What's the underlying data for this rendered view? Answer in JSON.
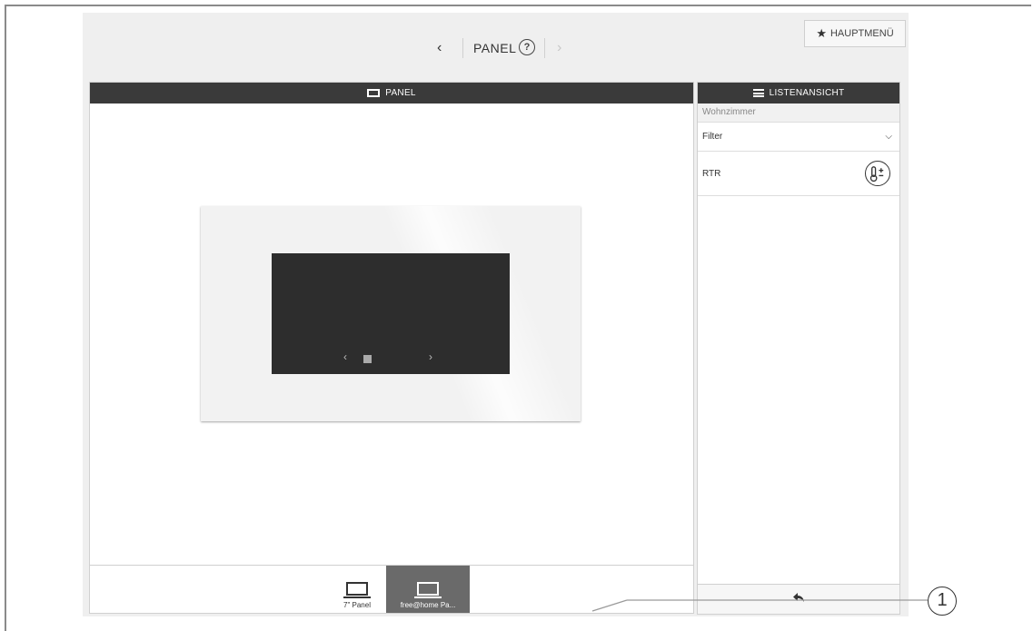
{
  "topnav": {
    "back_icon": "chevron-left-icon",
    "title": "PANEL",
    "help_icon": "question-circle-icon",
    "forward_icon": "chevron-right-icon",
    "main_menu_label": "HAUPTMENÜ",
    "main_menu_icon": "star-icon"
  },
  "panel": {
    "header_label": "PANEL",
    "header_icon": "monitor-icon",
    "device_screen": {
      "prev_icon": "chevron-left-icon",
      "page_indicator_icon": "square-icon",
      "next_icon": "chevron-right-icon"
    },
    "footer_tabs": [
      {
        "label": "7\" Panel",
        "icon": "monitor-icon",
        "active": false
      },
      {
        "label": "free@home Pa...",
        "icon": "monitor-icon",
        "active": true
      }
    ]
  },
  "list_view": {
    "header_label": "LISTENANSICHT",
    "header_icon": "list-icon",
    "room": "Wohnzimmer",
    "filter_label": "Filter",
    "filter_icon": "chevron-down-icon",
    "items": [
      {
        "label": "RTR",
        "icon": "thermostat-plus-minus-icon"
      }
    ],
    "back_icon": "back-arrow-icon"
  },
  "callout": {
    "number": "1"
  },
  "colors": {
    "header_bg": "#3a3a3a",
    "active_tab_bg": "#6a6a6a",
    "app_bg": "#efefef",
    "device_screen": "#2d2d2d"
  }
}
